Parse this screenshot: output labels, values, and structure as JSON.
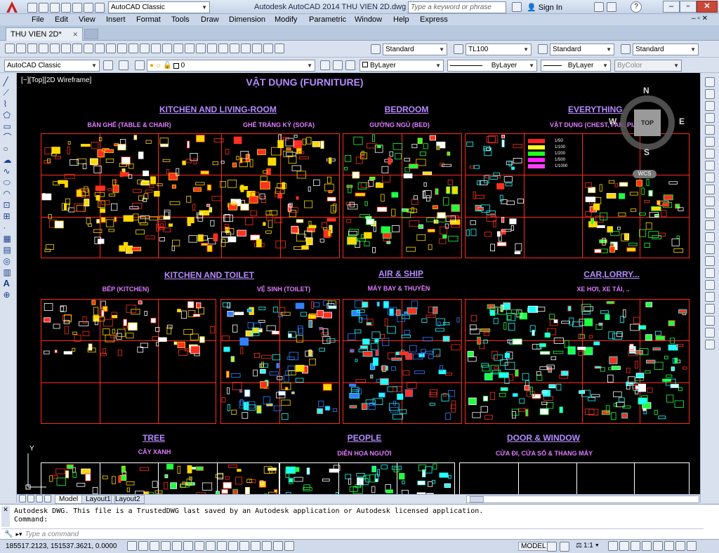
{
  "app": {
    "title": "Autodesk AutoCAD 2014    THU VIEN 2D.dwg",
    "workspace": "AutoCAD Classic",
    "search_placeholder": "Type a keyword or phrase",
    "sign_in": "Sign In",
    "help": "?"
  },
  "menu": [
    "File",
    "Edit",
    "View",
    "Insert",
    "Format",
    "Tools",
    "Draw",
    "Dimension",
    "Modify",
    "Parametric",
    "Window",
    "Help",
    "Express"
  ],
  "doc_tab": "THU VIEN 2D*",
  "styles": {
    "text_style": "Standard",
    "dim_style": "TL100",
    "table_style": "Standard",
    "mleader_style": "Standard"
  },
  "layers": {
    "workspace": "AutoCAD Classic",
    "layer": "0",
    "color": "ByLayer",
    "linetype": "ByLayer",
    "lineweight": "ByLayer",
    "plotstyle": "ByColor"
  },
  "viewport_label": "[−][Top][2D Wireframe]",
  "viewcube": {
    "n": "N",
    "s": "S",
    "e": "E",
    "w": "W",
    "top": "TOP",
    "wcs": "WCS"
  },
  "drawing": {
    "main_title": "VẬT DỤNG (FURNITURE)",
    "sections": [
      {
        "title": "KITCHEN AND LIVING-ROOM",
        "subs": [
          "BÀN GHẾ (TABLE & CHAIR)",
          "GHẾ TRÁNG KỶ (SOFA)"
        ]
      },
      {
        "title": "BEDROOM",
        "subs": [
          "GƯỜNG NGỦ (BED)"
        ]
      },
      {
        "title": "EVERYTHING",
        "subs": [
          "VẬT DỤNG (CHEST, FAN, PIANO, ...)"
        ]
      },
      {
        "title": "KITCHEN AND TOILET",
        "subs": [
          "BẾP (KITCHEN)",
          "VỆ SINH (TOILET)"
        ]
      },
      {
        "title": "AIR & SHIP",
        "subs": [
          "MÁY BAY & THUYỀN"
        ]
      },
      {
        "title": "CAR,LORRY...",
        "subs": [
          "XE HƠI, XE TẢI, .."
        ]
      },
      {
        "title": "TREE",
        "subs": [
          "CÂY XANH"
        ]
      },
      {
        "title": "PEOPLE",
        "subs": [
          "DIỄN HỌA NGƯỜI"
        ]
      },
      {
        "title": "DOOR & WINDOW",
        "subs": [
          "CỬA ĐI, CỬA SỔ & THANG MÁY"
        ]
      }
    ],
    "scales": [
      "1/50",
      "1/100",
      "1/200",
      "1/500",
      "1/1000"
    ]
  },
  "layout_tabs": [
    "Model",
    "Layout1",
    "Layout2"
  ],
  "command": {
    "history": "Autodesk DWG.  This file is a TrustedDWG last saved by an Autodesk application or Autodesk licensed application.",
    "prompt": "Command:",
    "placeholder": "Type a command"
  },
  "status": {
    "coords": "185517.2123, 151537.3621, 0.0000",
    "model": "MODEL",
    "scale": "1:1"
  },
  "colors": {
    "frame": "#ff2a1a",
    "title": "#b58bff",
    "sub": "#e07bff"
  }
}
